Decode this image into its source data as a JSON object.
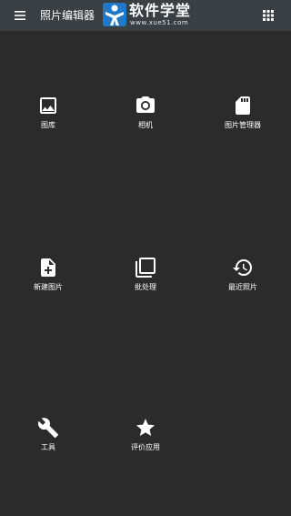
{
  "app": {
    "title": "照片编辑器"
  },
  "watermark": {
    "title": "软件学堂",
    "url": "www.xue51.com"
  },
  "menu": [
    {
      "label": "图库",
      "icon": "image-icon"
    },
    {
      "label": "相机",
      "icon": "camera-icon"
    },
    {
      "label": "图片管理器",
      "icon": "sd-card-icon"
    },
    {
      "label": "新建图片",
      "icon": "new-file-icon"
    },
    {
      "label": "批处理",
      "icon": "stacked-images-icon"
    },
    {
      "label": "最近照片",
      "icon": "history-icon"
    },
    {
      "label": "工具",
      "icon": "wrench-icon"
    },
    {
      "label": "评价应用",
      "icon": "star-icon"
    }
  ]
}
